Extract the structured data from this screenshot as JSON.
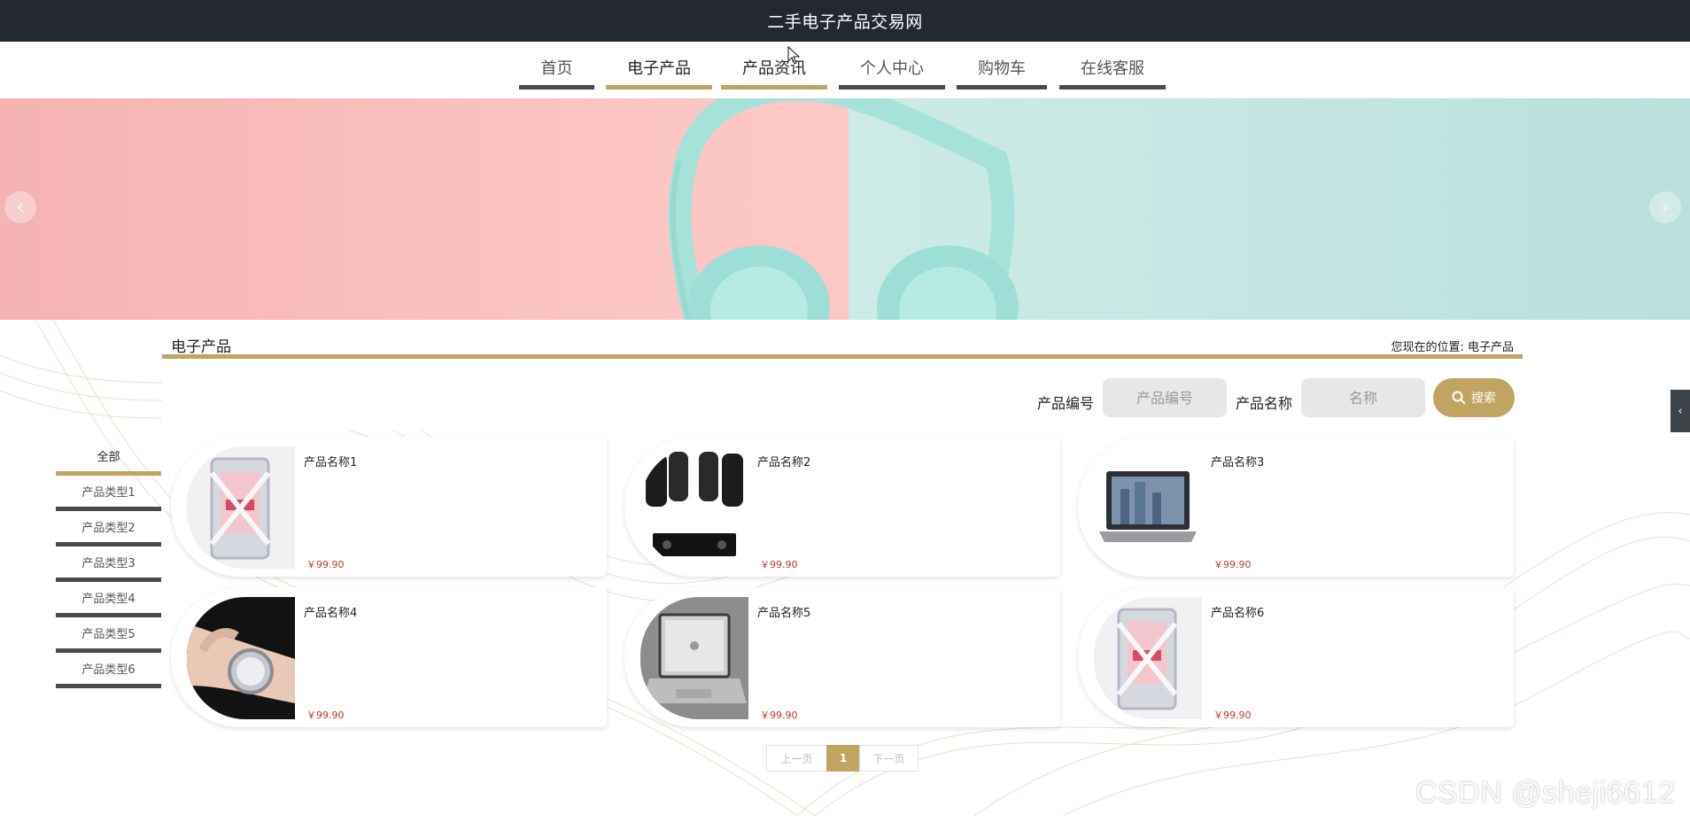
{
  "header": {
    "site_title": "二手电子产品交易网"
  },
  "nav": [
    {
      "label": "首页",
      "active": false
    },
    {
      "label": "电子产品",
      "active": true
    },
    {
      "label": "产品资讯",
      "active": true
    },
    {
      "label": "个人中心",
      "active": false
    },
    {
      "label": "购物车",
      "active": false
    },
    {
      "label": "在线客服",
      "active": false
    }
  ],
  "banner": {
    "prev_icon": "chevron-left-icon",
    "next_icon": "chevron-right-icon"
  },
  "section": {
    "title": "电子产品",
    "breadcrumb_prefix": "您现在的位置:",
    "breadcrumb_current": "电子产品"
  },
  "search": {
    "code_label": "产品编号",
    "code_placeholder": "产品编号",
    "name_label": "产品名称",
    "name_placeholder": "名称",
    "button_label": "搜索"
  },
  "categories": [
    {
      "label": "全部",
      "active": true
    },
    {
      "label": "产品类型1",
      "active": false
    },
    {
      "label": "产品类型2",
      "active": false
    },
    {
      "label": "产品类型3",
      "active": false
    },
    {
      "label": "产品类型4",
      "active": false
    },
    {
      "label": "产品类型5",
      "active": false
    },
    {
      "label": "产品类型6",
      "active": false
    }
  ],
  "products": [
    {
      "name": "产品名称1",
      "price": "￥99.90",
      "image": "pc-case"
    },
    {
      "name": "产品名称2",
      "price": "￥99.90",
      "image": "speakers"
    },
    {
      "name": "产品名称3",
      "price": "￥99.90",
      "image": "laptop"
    },
    {
      "name": "产品名称4",
      "price": "￥99.90",
      "image": "watch"
    },
    {
      "name": "产品名称5",
      "price": "￥99.90",
      "image": "macbook"
    },
    {
      "name": "产品名称6",
      "price": "￥99.90",
      "image": "pc-case"
    }
  ],
  "pagination": {
    "prev": "上一页",
    "current": "1",
    "next": "下一页"
  },
  "watermark": "CSDN @sheji6612",
  "colors": {
    "accent": "#bfa463",
    "topbar": "#232833",
    "nav_bar": "#4a4a4a",
    "price": "#c0392b"
  }
}
